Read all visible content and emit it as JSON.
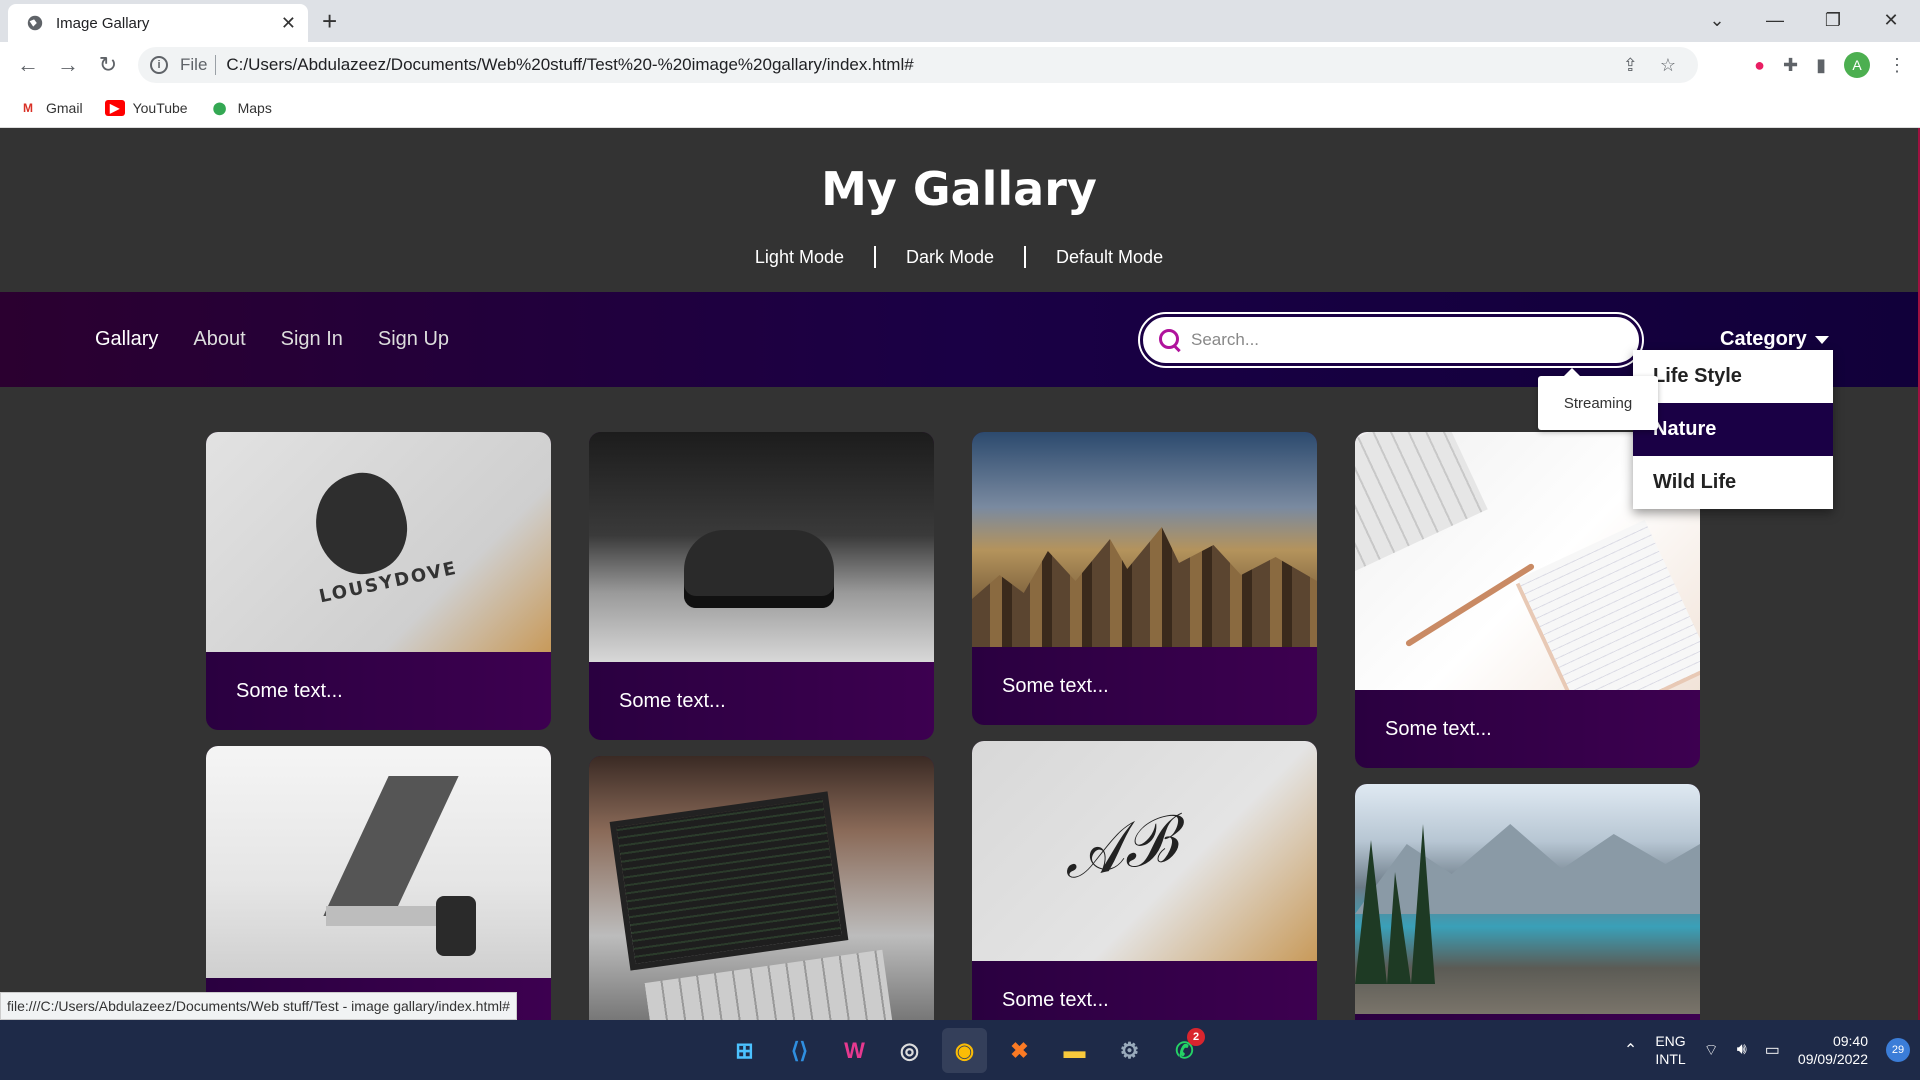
{
  "browser": {
    "tab_title": "Image Gallary",
    "new_tab": "+",
    "close_tab": "✕",
    "url_scheme": "File",
    "url": "C:/Users/Abdulazeez/Documents/Web%20stuff/Test%20-%20image%20gallary/index.html#",
    "bookmarks": [
      {
        "label": "Gmail",
        "icon": "gmail-icon",
        "color": "#d93025"
      },
      {
        "label": "YouTube",
        "icon": "youtube-icon",
        "color": "#ff0000"
      },
      {
        "label": "Maps",
        "icon": "maps-icon",
        "color": "#34a853"
      }
    ],
    "profile_initial": "A",
    "status_url": "file:///C:/Users/Abdulazeez/Documents/Web stuff/Test - image gallary/index.html#"
  },
  "site": {
    "title": "My Gallary",
    "modes": [
      "Light Mode",
      "Dark Mode",
      "Default Mode"
    ],
    "nav": [
      "Gallary",
      "About",
      "Sign In",
      "Sign Up"
    ],
    "search_placeholder": "Search...",
    "category_label": "Category",
    "category_options": [
      "Life Style",
      "Nature",
      "Wild Life"
    ],
    "category_active": "Nature",
    "tooltip": "Streaming",
    "colors": {
      "accent": "#b0139c",
      "navbar": "#1a0045",
      "background": "#333333"
    }
  },
  "gallery": {
    "caption": "Some text...",
    "cards": [
      {
        "image": "lousydove-logo-mockup",
        "brand_text": "LOUSYDOVE",
        "caption": "Some text..."
      },
      {
        "image": "sports-car-garage",
        "caption": "Some text..."
      },
      {
        "image": "city-skyline",
        "caption": "Some text..."
      },
      {
        "image": "desk-keyboard-notebook",
        "caption": "Some text..."
      },
      {
        "image": "laptop-desk-white",
        "caption": ""
      },
      {
        "image": "laptop-code",
        "caption": ""
      },
      {
        "image": "signature-mockup",
        "caption": "Some text..."
      },
      {
        "image": "mountain-lake",
        "caption": ""
      }
    ]
  },
  "taskbar": {
    "apps": [
      "windows-start-icon",
      "vscode-icon",
      "wamp-icon",
      "obs-icon",
      "chrome-icon",
      "xampp-icon",
      "file-explorer-icon",
      "settings-icon",
      "whatsapp-icon"
    ],
    "whatsapp_badge": "2",
    "lang_top": "ENG",
    "lang_bottom": "INTL",
    "time": "09:40",
    "date": "09/09/2022",
    "notifications": "29"
  }
}
